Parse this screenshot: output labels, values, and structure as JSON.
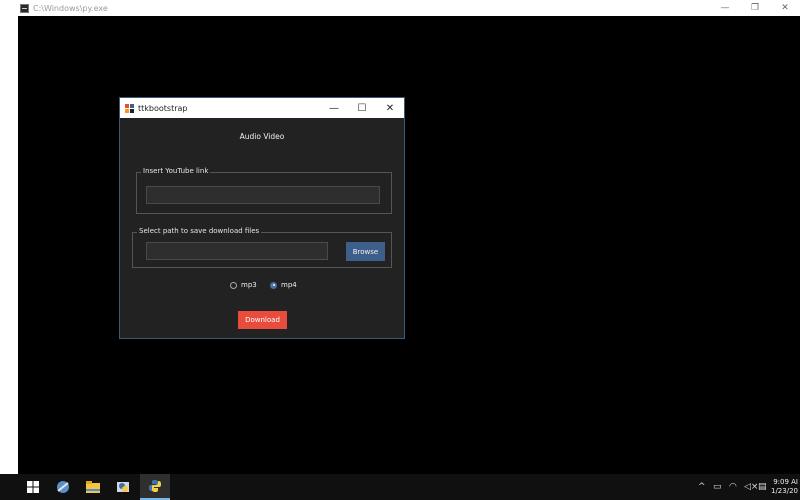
{
  "console": {
    "title": "C:\\Windows\\py.exe",
    "controls": [
      "—",
      "❐",
      "✕"
    ]
  },
  "app": {
    "title": "ttkbootstrap",
    "controls": [
      "—",
      "☐",
      "✕"
    ],
    "heading": "Audio Video",
    "link_group": {
      "label": "Insert YouTube link",
      "value": ""
    },
    "path_group": {
      "label": "Select path to save download files",
      "value": "",
      "browse_label": "Browse"
    },
    "format_options": [
      {
        "label": "mp3",
        "selected": false
      },
      {
        "label": "mp4",
        "selected": true
      }
    ],
    "download_label": "Download",
    "colors": {
      "background": "#222222",
      "primary": "#3e5f8a",
      "danger": "#e74c3c"
    }
  },
  "taskbar": {
    "items": [
      "windows-start-icon",
      "app-icon",
      "file-explorer-icon",
      "python-idle-icon",
      "python-icon"
    ],
    "tray": [
      "chevron-up-icon",
      "keyboard-icon",
      "network-icon",
      "volume-icon",
      "notification-icon"
    ],
    "time": "9:09 AI",
    "date": "1/23/20"
  }
}
